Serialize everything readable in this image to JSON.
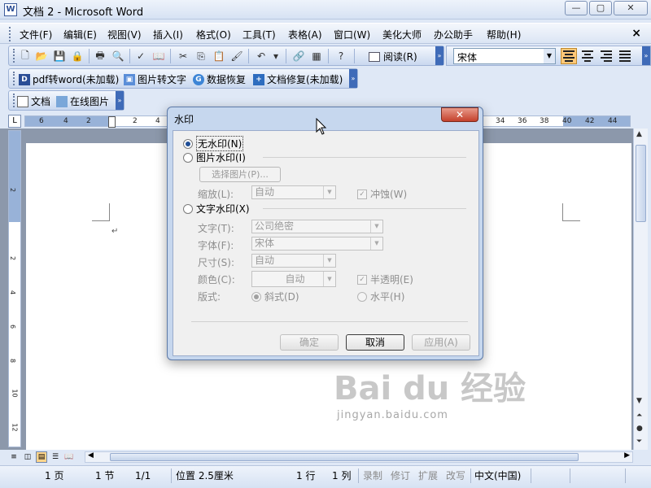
{
  "window": {
    "title": "文档 2 - Microsoft Word",
    "icon": "word-doc-icon"
  },
  "menubar": {
    "items": [
      "文件(F)",
      "编辑(E)",
      "视图(V)",
      "插入(I)",
      "格式(O)",
      "工具(T)",
      "表格(A)",
      "窗口(W)",
      "美化大师",
      "办公助手",
      "帮助(H)"
    ],
    "close": "×"
  },
  "toolbar_standard": {
    "read_label": "阅读(R)"
  },
  "toolbar_format": {
    "font": "宋体"
  },
  "toolbar_plugins": {
    "items": [
      "pdf转word(未加载)",
      "图片转文字",
      "数据恢复",
      "文档修复(未加载)"
    ]
  },
  "toolbar_online": {
    "items": [
      "文档",
      "在线图片"
    ]
  },
  "ruler": {
    "corner": "L",
    "numbers": [
      "6",
      "4",
      "2",
      "2",
      "4",
      "34",
      "36",
      "38",
      "40",
      "42",
      "44"
    ],
    "vertical_numbers": [
      "2",
      "2",
      "4",
      "6",
      "8",
      "10",
      "12"
    ]
  },
  "dialog": {
    "title": "水印",
    "close": "✕",
    "no_watermark": "无水印(N)",
    "picture_watermark": "图片水印(I)",
    "select_picture": "选择图片(P)...",
    "scale_label": "缩放(L):",
    "scale_value": "自动",
    "washout_label": "冲蚀(W)",
    "text_watermark": "文字水印(X)",
    "text_label": "文字(T):",
    "text_value": "公司绝密",
    "font_label": "字体(F):",
    "font_value": "宋体",
    "size_label": "尺寸(S):",
    "size_value": "自动",
    "color_label": "颜色(C):",
    "color_value": "自动",
    "semitransparent_label": "半透明(E)",
    "layout_label": "版式:",
    "diagonal_label": "斜式(D)",
    "horizontal_label": "水平(H)",
    "ok": "确定",
    "cancel": "取消",
    "apply": "应用(A)"
  },
  "statusbar": {
    "page": "1 页",
    "section": "1 节",
    "page_of": "1/1",
    "position": "位置 2.5厘米",
    "line": "1 行",
    "column": "1 列",
    "rec": "录制",
    "trk": "修订",
    "ext": "扩展",
    "ovr": "改写",
    "language": "中文(中国)"
  },
  "watermark": {
    "main": "Bai du 经验",
    "sub": "jingyan.baidu.com"
  },
  "colors": {
    "accent": "#3f6bb8",
    "dialog_frame": "#c6d7ee",
    "close_red": "#c4412c"
  }
}
